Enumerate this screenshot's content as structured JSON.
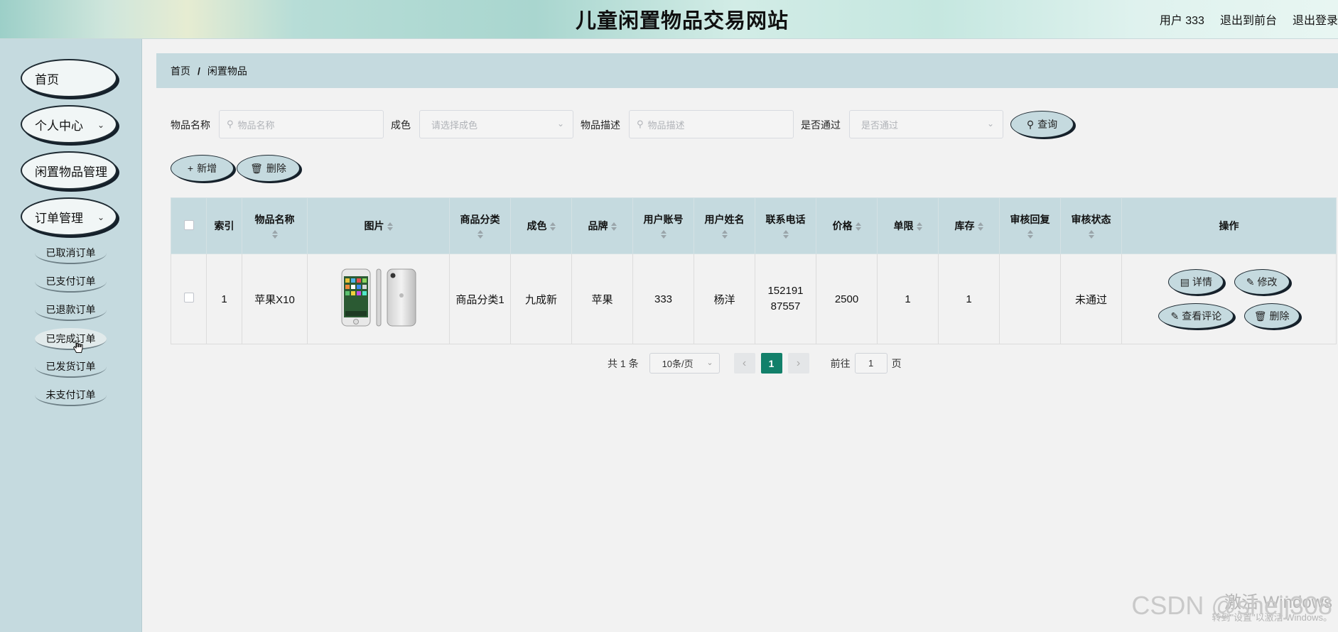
{
  "header": {
    "title": "儿童闲置物品交易网站",
    "user_label": "用户 333",
    "exit_front_label": "退出到前台",
    "logout_label": "退出登录"
  },
  "sidebar": {
    "menu": [
      {
        "label": "首页",
        "expandable": false
      },
      {
        "label": "个人中心",
        "expandable": true
      },
      {
        "label": "闲置物品管理",
        "expandable": false
      },
      {
        "label": "订单管理",
        "expandable": true
      }
    ],
    "order_submenu": [
      "已取消订单",
      "已支付订单",
      "已退款订单",
      "已完成订单",
      "已发货订单",
      "未支付订单"
    ]
  },
  "breadcrumb": {
    "home": "首页",
    "separator": "/",
    "current": "闲置物品"
  },
  "search": {
    "name_label": "物品名称",
    "name_placeholder": "物品名称",
    "condition_label": "成色",
    "condition_placeholder": "请选择成色",
    "desc_label": "物品描述",
    "desc_placeholder": "物品描述",
    "approved_label": "是否通过",
    "approved_placeholder": "是否通过",
    "query_button": "查询"
  },
  "toolbar": {
    "add_label": "新增",
    "delete_label": "删除"
  },
  "table": {
    "headers": {
      "index": "索引",
      "name": "物品名称",
      "image": "图片",
      "category": "商品分类",
      "condition": "成色",
      "brand": "品牌",
      "account": "用户账号",
      "username": "用户姓名",
      "phone": "联系电话",
      "price": "价格",
      "limit": "单限",
      "stock": "库存",
      "review_reply": "审核回复",
      "review_status": "审核状态",
      "actions": "操作"
    },
    "rows": [
      {
        "index": "1",
        "name": "苹果X10",
        "category": "商品分类1",
        "condition": "九成新",
        "brand": "苹果",
        "account": "333",
        "username": "杨洋",
        "phone": "15219187557",
        "price": "2500",
        "limit": "1",
        "stock": "1",
        "review_reply": "",
        "review_status": "未通过"
      }
    ],
    "row_actions": {
      "detail": "详情",
      "edit": "修改",
      "comments": "查看评论",
      "delete": "删除"
    }
  },
  "pagination": {
    "total": "共 1 条",
    "page_size": "10条/页",
    "current_page": "1",
    "goto_prefix": "前往",
    "goto_value": "1",
    "goto_suffix": "页"
  },
  "watermark": {
    "line1": "激活 Windows",
    "line2": "转到\"设置\"以激活 Windows。",
    "csdn": "CSDN @shejj308"
  },
  "colors": {
    "sidebar_bg": "#c5dadf",
    "table_header_bg": "#c5dadf",
    "pagination_active": "#12806a",
    "page_bg": "#f2f2f2"
  }
}
